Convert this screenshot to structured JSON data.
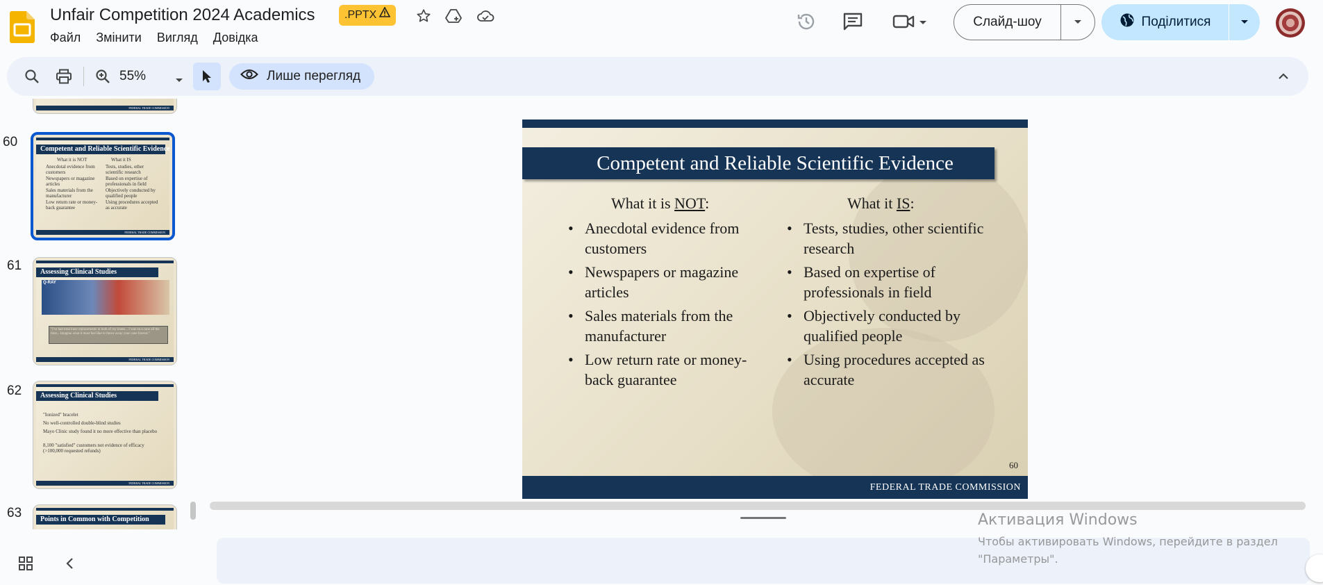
{
  "header": {
    "title": "Unfair Competition 2024 Academics",
    "file_badge": ".PPTX",
    "menu": [
      "Файл",
      "Змінити",
      "Вигляд",
      "Довідка"
    ],
    "slideshow_label": "Слайд-шоу",
    "share_label": "Поділитися"
  },
  "toolbar": {
    "zoom": "55%",
    "view_mode_label": "Лише перегляд"
  },
  "filmstrip": {
    "slides": [
      {
        "number": "60",
        "title": "Competent and Reliable Scientific Evidence",
        "selected": true
      },
      {
        "number": "61",
        "title": "Assessing Clinical Studies",
        "selected": false
      },
      {
        "number": "62",
        "title": "Assessing Clinical Studies",
        "selected": false
      },
      {
        "number": "63",
        "title": "Points in Common with Competition",
        "selected": false
      }
    ],
    "slide60_text": {
      "left_head": "What it is NOT",
      "right_head": "What it IS",
      "left": [
        "Anecdotal evidence from customers",
        "Newspapers or magazine articles",
        "Sales materials from the manufacturer",
        "Low return rate or money-back guarantee"
      ],
      "right": [
        "Tests, studies, other scientific research",
        "Based on expertise of professionals in field",
        "Objectively conducted by qualified people",
        "Using procedures accepted as accurate"
      ]
    },
    "slide61_text": {
      "brand": "Q-RAY",
      "quote": "\"I've had total knee replacements in both of my knees... I was on a cane all the time... Imagine what it must feel like to throw away your cane forever.\""
    },
    "slide62_text": {
      "bullets": [
        "\"Ionized\" bracelet",
        "No well-controlled double-blind studies",
        "Mayo Clinic study found it no more effective than placebo",
        "8,100 \"satisfied\" customers not evidence of efficacy (>100,000 requested refunds)"
      ]
    },
    "footer_text": "FEDERAL TRADE COMMISSION"
  },
  "slide": {
    "title": "Competent and Reliable Scientific Evidence",
    "left_head_prefix": "What it is ",
    "left_head_emph": "NOT",
    "right_head_prefix": "What it ",
    "right_head_emph": "IS",
    "head_suffix": ":",
    "left_bullets": [
      "Anecdotal evidence from customers",
      "Newspapers or magazine articles",
      "Sales materials from the manufacturer",
      "Low return rate or money-back guarantee"
    ],
    "right_bullets": [
      "Tests, studies, other scientific research",
      "Based on expertise of professionals in field",
      "Objectively conducted by qualified people",
      "Using procedures accepted as accurate"
    ],
    "page_number": "60",
    "footer": "FEDERAL TRADE COMMISSION"
  },
  "watermark": {
    "title": "Активация Windows",
    "line1": "Чтобы активировать Windows, перейдите в раздел",
    "line2": "\"Параметры\"."
  },
  "colors": {
    "accent": "#0b57d0",
    "share_bg": "#c2e7ff",
    "slide_navy": "#163455",
    "badge": "#fdc332"
  },
  "icons": [
    "slides-logo-icon",
    "warning-icon",
    "star-icon",
    "add-to-drive-icon",
    "cloud-status-icon",
    "history-icon",
    "comment-icon",
    "meet-icon",
    "chevron-down-icon",
    "globe-icon",
    "search-icon",
    "print-icon",
    "zoom-in-icon",
    "cursor-icon",
    "eye-icon",
    "chevron-up-icon",
    "grid-view-icon",
    "chevron-left-icon"
  ]
}
